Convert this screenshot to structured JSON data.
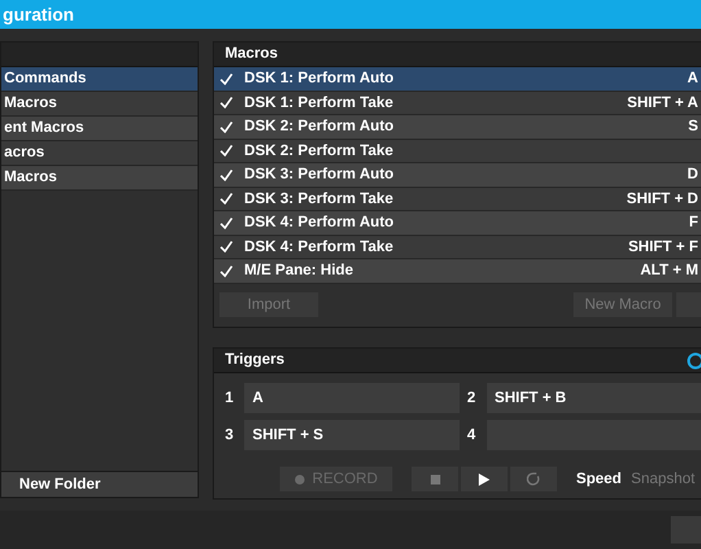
{
  "window": {
    "title": "guration"
  },
  "folders": {
    "items": [
      {
        "label": "Commands",
        "selected": true
      },
      {
        "label": "Macros",
        "selected": false
      },
      {
        "label": "ent Macros",
        "selected": false
      },
      {
        "label": "acros",
        "selected": false
      },
      {
        "label": "Macros",
        "selected": false
      }
    ],
    "new_folder": "New Folder"
  },
  "macros": {
    "title": "Macros",
    "rows": [
      {
        "name": "DSK 1: Perform Auto",
        "shortcut": "A",
        "checked": true,
        "selected": true
      },
      {
        "name": "DSK 1: Perform Take",
        "shortcut": "SHIFT + A",
        "checked": true,
        "selected": false
      },
      {
        "name": "DSK 2: Perform Auto",
        "shortcut": "S",
        "checked": true,
        "selected": false
      },
      {
        "name": "DSK 2: Perform Take",
        "checked": true,
        "selected": false
      },
      {
        "name": "DSK 3: Perform Auto",
        "shortcut": "D",
        "checked": true,
        "selected": false
      },
      {
        "name": "DSK 3: Perform Take",
        "shortcut": "SHIFT + D",
        "checked": true,
        "selected": false
      },
      {
        "name": "DSK 4: Perform Auto",
        "shortcut": "F",
        "checked": true,
        "selected": false
      },
      {
        "name": "DSK 4: Perform Take",
        "shortcut": "SHIFT + F",
        "checked": true,
        "selected": false
      },
      {
        "name": "M/E Pane: Hide",
        "shortcut": "ALT + M",
        "checked": true,
        "selected": false
      }
    ],
    "import": "Import",
    "new_macro": "New Macro"
  },
  "triggers": {
    "title": "Triggers",
    "slots": [
      {
        "number": "1",
        "value": "A"
      },
      {
        "number": "2",
        "value": "SHIFT + B"
      },
      {
        "number": "3",
        "value": "SHIFT + S"
      },
      {
        "number": "4"
      }
    ],
    "record": {
      "label": "RECORD",
      "disabled": true
    },
    "modes": [
      {
        "label": "Speed",
        "selected": true
      },
      {
        "label": "Snapshot",
        "selected": false
      }
    ]
  }
}
